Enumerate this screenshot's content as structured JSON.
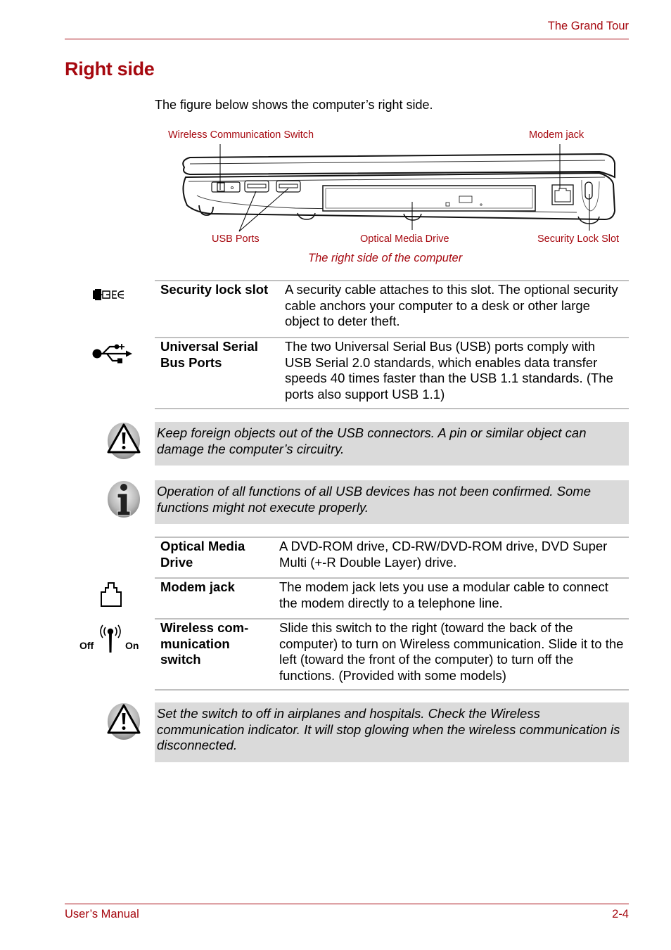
{
  "header": {
    "section_title": "The Grand Tour"
  },
  "page": {
    "title": "Right side",
    "intro": "The figure below shows the computer’s right side."
  },
  "figure": {
    "labels": {
      "wireless_switch": "Wireless Communication Switch",
      "modem_jack": "Modem jack",
      "usb_ports": "USB Ports",
      "optical_drive": "Optical Media Drive",
      "security_lock": "Security Lock Slot"
    },
    "caption": "The right side of the computer"
  },
  "table1": [
    {
      "icon": "security-lock-icon",
      "term": "Security lock slot",
      "definition": "A security cable attaches to this slot. The optional security cable anchors your computer to a desk or other large object to deter theft."
    },
    {
      "icon": "usb-icon",
      "term": "Universal Serial Bus Ports",
      "definition": "The two Universal Serial Bus (USB) ports comply with USB Serial 2.0 standards, which enables data transfer speeds 40 times faster than the USB 1.1 standards. (The ports also support USB 1.1)"
    }
  ],
  "notes1": [
    {
      "icon": "warning-icon",
      "text": "Keep foreign objects out of the USB connectors. A pin or similar object can damage the computer’s circuitry."
    },
    {
      "icon": "info-icon",
      "text": "Operation of all functions of all USB devices has not been confirmed. Some functions might not execute properly."
    }
  ],
  "table2": [
    {
      "icon": "",
      "term": "Optical Media Drive",
      "definition": "A DVD-ROM drive, CD-RW/DVD-ROM drive, DVD Super Multi (+-R Double Layer) drive."
    },
    {
      "icon": "modem-jack-icon",
      "term": "Modem jack",
      "definition": "The modem jack lets you use a modular cable to connect the modem directly to a telephone line."
    },
    {
      "icon": "wireless-switch-icon",
      "term": "Wireless com-munication switch",
      "definition": "Slide this switch to the right (toward the back of the computer) to turn on Wireless communication. Slide it to the left (toward the front of the computer) to turn off the functions. (Provided with some models)"
    }
  ],
  "wireless_icon_labels": {
    "off": "Off",
    "on": "On"
  },
  "notes2": [
    {
      "icon": "warning-icon",
      "text": "Set the switch to off in airplanes and hospitals. Check the Wireless communication indicator. It will stop glowing when the wireless communication is disconnected."
    }
  ],
  "footer": {
    "left": "User’s Manual",
    "right": "2-4"
  },
  "colors": {
    "accent": "#a6080f",
    "note_bg": "#dadada",
    "rule": "#c0c0c0"
  }
}
